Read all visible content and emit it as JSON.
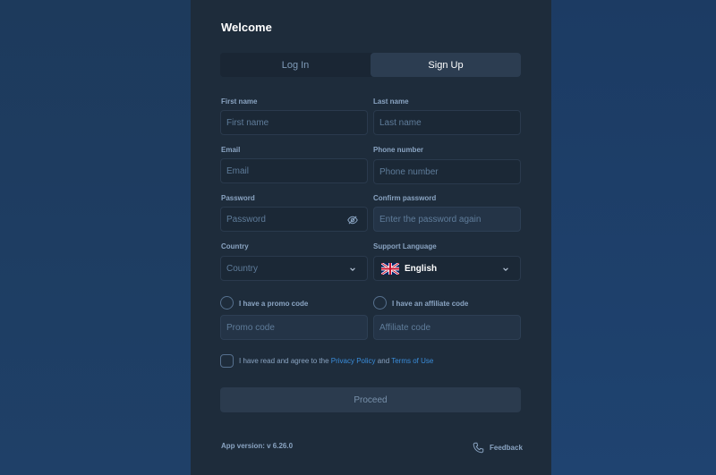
{
  "title": "Welcome",
  "tabs": {
    "login": "Log In",
    "signup": "Sign Up"
  },
  "form": {
    "first_name": {
      "label": "First name",
      "placeholder": "First name"
    },
    "last_name": {
      "label": "Last name",
      "placeholder": "Last name"
    },
    "email": {
      "label": "Email",
      "placeholder": "Email"
    },
    "phone": {
      "label": "Phone number",
      "placeholder": "Phone number"
    },
    "password": {
      "label": "Password",
      "placeholder": "Password"
    },
    "confirm_password": {
      "label": "Confirm password",
      "placeholder": "Enter the password again"
    },
    "country": {
      "label": "Country",
      "placeholder": "Country"
    },
    "language": {
      "label": "Support Language",
      "value": "English"
    },
    "promo": {
      "checkbox_label": "I have a promo code",
      "placeholder": "Promo code"
    },
    "affiliate": {
      "checkbox_label": "I have an affiliate code",
      "placeholder": "Affiliate code"
    },
    "terms": {
      "prefix": "I have read and agree to the",
      "privacy": "Privacy Policy",
      "and": "and",
      "terms_of_use": "Terms of Use"
    },
    "proceed": "Proceed"
  },
  "footer": {
    "version": "App version: v 6.26.0",
    "feedback": "Feedback"
  },
  "colors": {
    "panel": "#1e2c3b",
    "accent_link": "#3a8ddb",
    "active_tab": "#2c3d51"
  },
  "icons": {
    "password_toggle": "eye-off-icon",
    "dropdown": "chevron-down-icon",
    "language_flag": "uk-flag-icon",
    "feedback": "phone-icon"
  }
}
